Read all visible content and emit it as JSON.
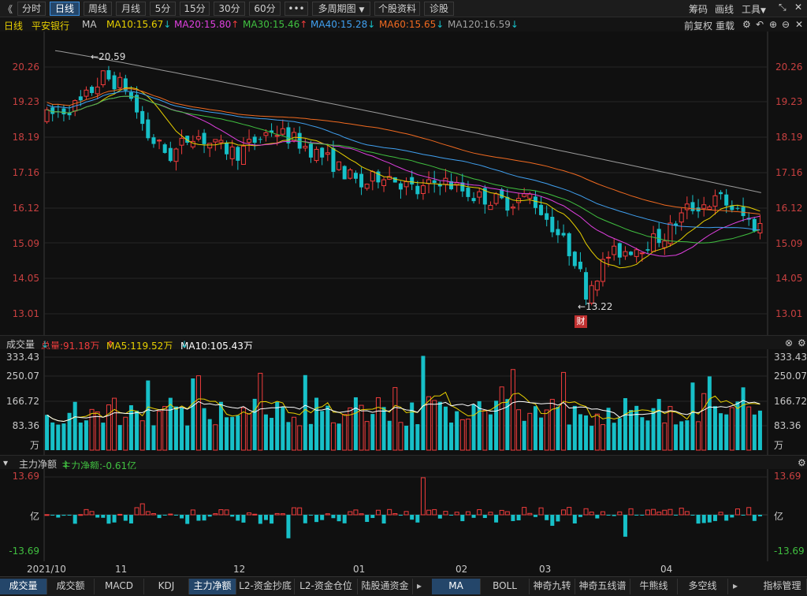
{
  "toolbar": {
    "back": "《",
    "periods": [
      "分时",
      "日线",
      "周线",
      "月线",
      "5分",
      "15分",
      "30分",
      "60分",
      "•••"
    ],
    "multi_period": "多周期图",
    "stock_info": "个股资料",
    "diagnose": "诊股",
    "chips": "筹码",
    "draw": "画线",
    "tools": "工具"
  },
  "ma_row": {
    "period": "日线",
    "name": "平安银行",
    "indicator": "MA",
    "ma": [
      {
        "label": "MA10:15.67",
        "arrow": "↓",
        "color": "#e8d000"
      },
      {
        "label": "MA20:15.80",
        "arrow": "↑",
        "color": "#e040e0"
      },
      {
        "label": "MA30:15.46",
        "arrow": "↑",
        "color": "#40c040"
      },
      {
        "label": "MA40:15.28",
        "arrow": "↓",
        "color": "#40a0f0"
      },
      {
        "label": "MA60:15.65",
        "arrow": "↓",
        "color": "#f06a20"
      },
      {
        "label": "MA120:16.59",
        "arrow": "↓",
        "color": "#a0a0a0"
      }
    ],
    "adjust": "前复权",
    "reload": "重载"
  },
  "price_axis": [
    "20.26",
    "19.23",
    "18.19",
    "17.16",
    "16.12",
    "15.09",
    "14.05",
    "13.01"
  ],
  "high_mark": "20.59",
  "low_mark": "13.22",
  "fin_badge": "财",
  "volume_hdr": {
    "title": "成交量",
    "total": "总量:91.18万",
    "total_arrow": "↓",
    "ma5": "MA5:119.52万",
    "ma5_arrow": "↑",
    "ma10": "MA10:105.43万",
    "ma10_arrow": "↓"
  },
  "volume_axis": [
    "333.43",
    "250.07",
    "166.72",
    "83.36",
    "万"
  ],
  "flow_hdr": {
    "title": "主力净额",
    "value": "主力净额:-0.61亿",
    "value_arrow": "↓"
  },
  "flow_axis": [
    "13.69",
    "亿",
    "-13.69"
  ],
  "date_axis": [
    "2021/10",
    "11",
    "12",
    "01",
    "02",
    "03",
    "04"
  ],
  "tabs_left": [
    "成交量",
    "成交额",
    "MACD",
    "KDJ",
    "主力净额",
    "L2-资金抄底",
    "L2-资金仓位",
    "陆股通资金"
  ],
  "tabs_right": [
    "MA",
    "BOLL",
    "神奇九转",
    "神奇五线谱",
    "牛熊线",
    "多空线"
  ],
  "tab_manage": "指标管理",
  "colors": {
    "up": "#f03c3c",
    "down": "#17c0c8",
    "bg": "#101010"
  },
  "icons": [
    "close-icon",
    "minimize-icon",
    "settings-icon",
    "undo-icon",
    "zoom-in-icon",
    "zoom-out-icon",
    "chevron-down-icon"
  ]
}
